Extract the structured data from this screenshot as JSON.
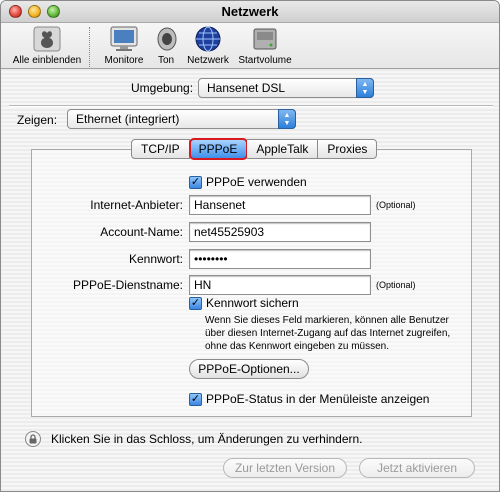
{
  "window": {
    "title": "Netzwerk"
  },
  "toolbar": {
    "items": [
      {
        "label": "Alle einblenden",
        "icon": "show-all-icon"
      },
      {
        "label": "Monitore",
        "icon": "monitor-icon"
      },
      {
        "label": "Ton",
        "icon": "speaker-icon"
      },
      {
        "label": "Netzwerk",
        "icon": "globe-icon"
      },
      {
        "label": "Startvolume",
        "icon": "disk-icon"
      }
    ]
  },
  "location": {
    "label": "Umgebung:",
    "value": "Hansenet DSL"
  },
  "show": {
    "label": "Zeigen:",
    "value": "Ethernet (integriert)"
  },
  "tabs": [
    {
      "label": "TCP/IP",
      "active": false
    },
    {
      "label": "PPPoE",
      "active": true
    },
    {
      "label": "AppleTalk",
      "active": false
    },
    {
      "label": "Proxies",
      "active": false
    }
  ],
  "pppoe": {
    "use_pppoe": {
      "label": "PPPoE verwenden",
      "checked": true
    },
    "provider": {
      "label": "Internet-Anbieter:",
      "value": "Hansenet",
      "hint": "(Optional)"
    },
    "account": {
      "label": "Account-Name:",
      "value": "net45525903"
    },
    "password": {
      "label": "Kennwort:",
      "value": "••••••••"
    },
    "service": {
      "label": "PPPoE-Dienstname:",
      "value": "HN",
      "hint": "(Optional)"
    },
    "save_password": {
      "label": "Kennwort sichern",
      "checked": true
    },
    "note_lines": [
      "Wenn Sie dieses Feld markieren, können alle Benutzer",
      "über diesen Internet-Zugang auf das Internet zugreifen,",
      "ohne das Kennwort eingeben zu müssen."
    ],
    "options_button": "PPPoE-Optionen...",
    "show_status": {
      "label": "PPPoE-Status in der Menüleiste anzeigen",
      "checked": true
    }
  },
  "footer": {
    "lock_text": "Klicken Sie in das Schloss, um Änderungen zu verhindern.",
    "revert_button": "Zur letzten Version",
    "apply_button": "Jetzt aktivieren"
  }
}
